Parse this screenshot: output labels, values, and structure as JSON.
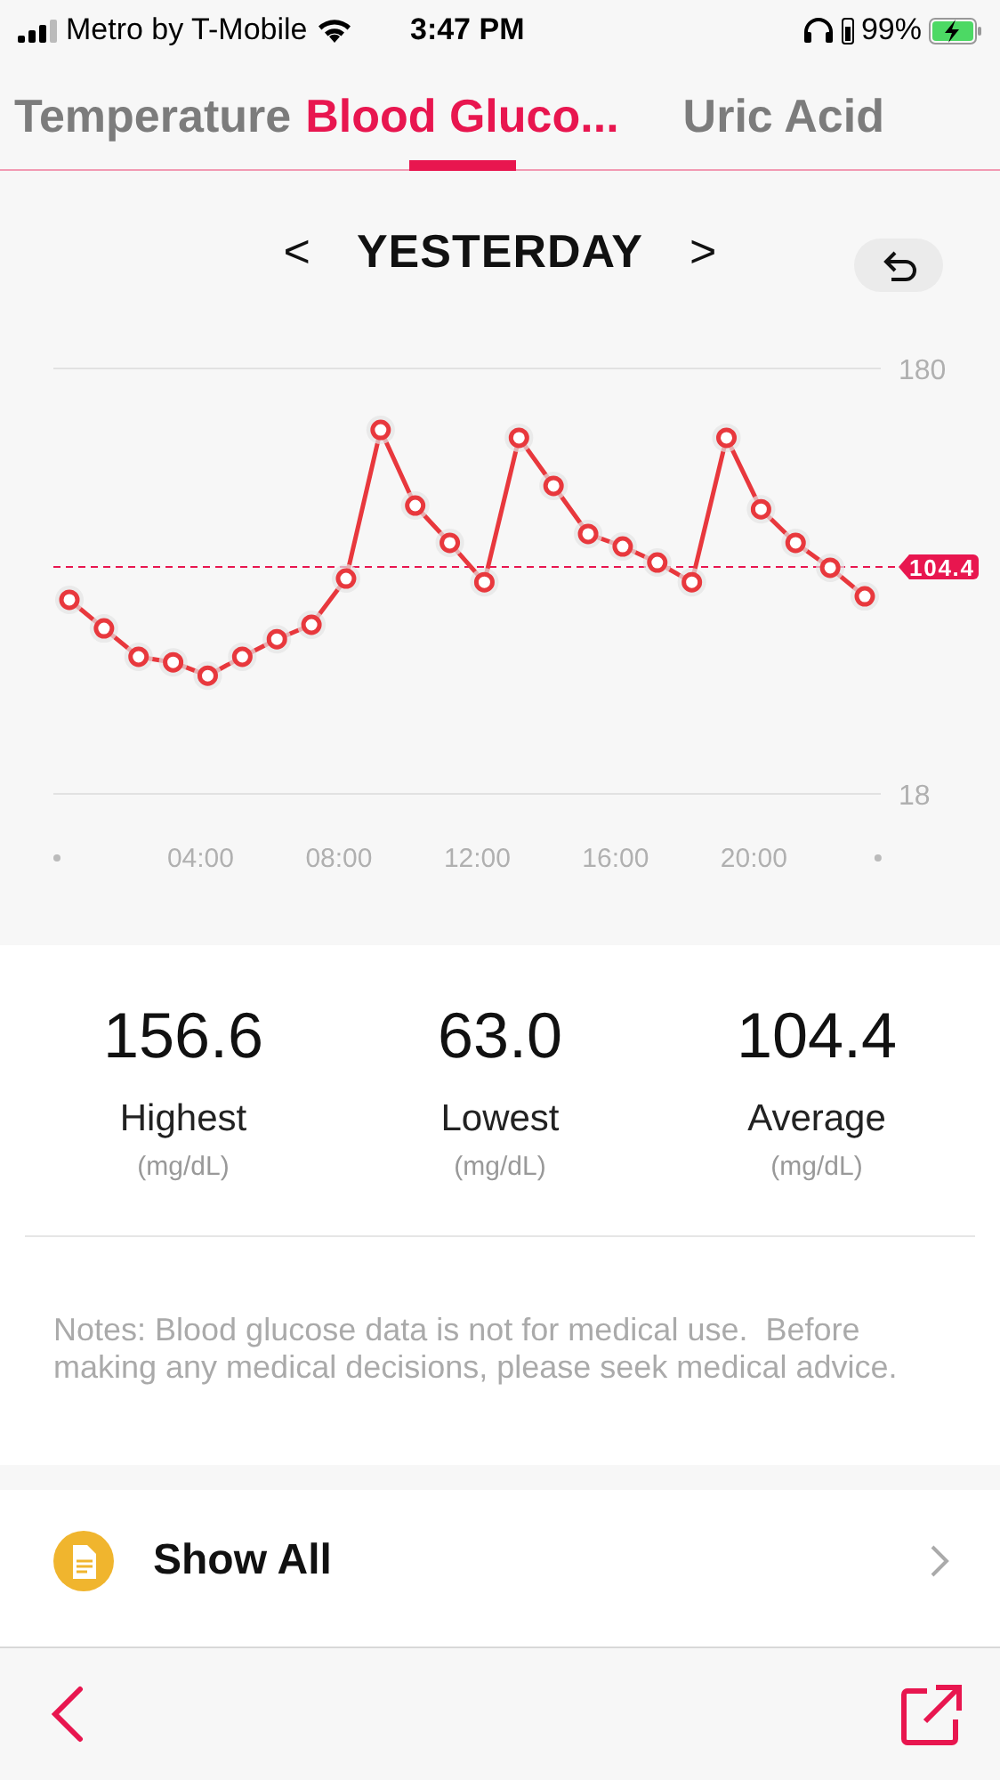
{
  "status_bar": {
    "carrier": "Metro by T-Mobile",
    "time": "3:47 PM",
    "battery": "99%"
  },
  "tabs": [
    {
      "label": "Temperature",
      "selected": false
    },
    {
      "label": "Blood Gluco...",
      "selected": true
    },
    {
      "label": "Uric Acid",
      "selected": false
    }
  ],
  "period": {
    "prev": "<",
    "label": "YESTERDAY",
    "next": ">"
  },
  "chart_data": {
    "type": "line",
    "x": [
      0,
      1,
      2,
      3,
      4,
      5,
      6,
      7,
      8,
      9,
      10,
      11,
      12,
      13,
      14,
      15,
      16,
      17,
      18,
      19,
      20,
      21,
      22,
      23
    ],
    "series": [
      {
        "color": "#e8383d",
        "marker": "o",
        "values": [
          91.9,
          81.0,
          70.2,
          68.1,
          63.0,
          70.2,
          76.9,
          82.4,
          100.0,
          156.6,
          127.8,
          113.6,
          98.6,
          153.6,
          135.3,
          117.0,
          112.2,
          106.1,
          98.6,
          153.6,
          126.4,
          113.6,
          104.1,
          93.2
        ]
      }
    ],
    "xlim": [
      0,
      24
    ],
    "ylim": [
      18,
      180
    ],
    "xticks": [
      {
        "value": 4,
        "label": "04:00"
      },
      {
        "value": 8,
        "label": "08:00"
      },
      {
        "value": 12,
        "label": "12:00"
      },
      {
        "value": 16,
        "label": "16:00"
      },
      {
        "value": 20,
        "label": "20:00"
      }
    ],
    "yticks": [
      18,
      180
    ],
    "ref_lines": [
      {
        "axis": "y",
        "value": 104.4,
        "label": "104.4"
      }
    ]
  },
  "stats": [
    {
      "value": "156.6",
      "label": "Highest",
      "unit": "(mg/dL)"
    },
    {
      "value": "63.0",
      "label": "Lowest",
      "unit": "(mg/dL)"
    },
    {
      "value": "104.4",
      "label": "Average",
      "unit": "(mg/dL)"
    }
  ],
  "notes": "Notes: Blood glucose data is not for medical use.  Before making any medical decisions, please seek medical advice.",
  "show_all": {
    "label": "Show All"
  }
}
